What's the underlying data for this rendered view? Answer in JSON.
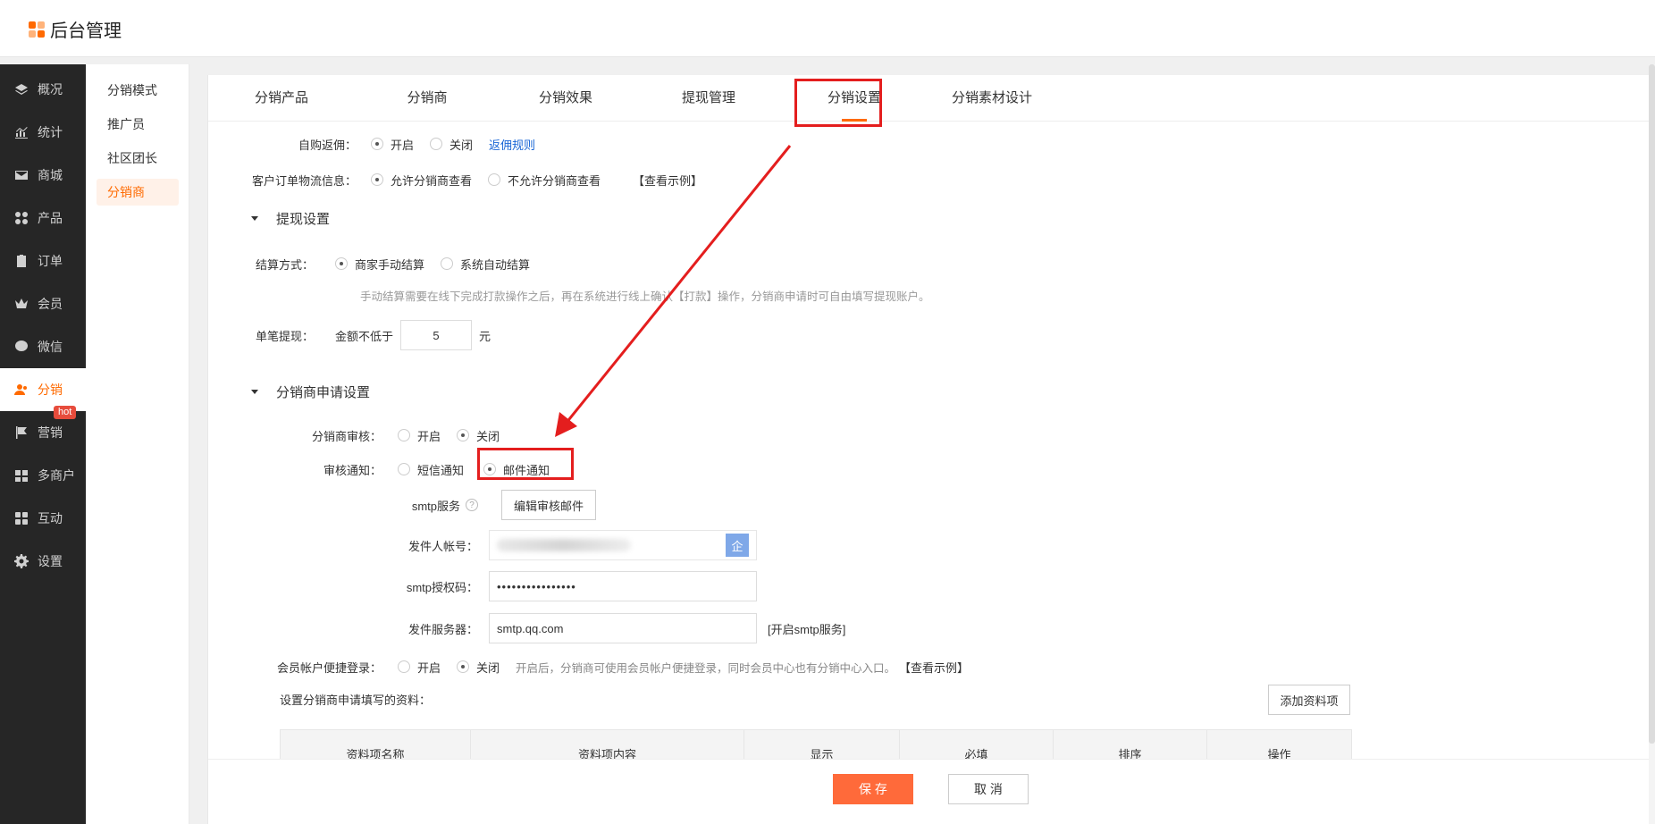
{
  "app": {
    "title": "后台管理"
  },
  "sidebar": {
    "items": [
      {
        "label": "概况",
        "icon": "layers-icon"
      },
      {
        "label": "统计",
        "icon": "chart-icon"
      },
      {
        "label": "商城",
        "icon": "mail-icon"
      },
      {
        "label": "产品",
        "icon": "grid-icon"
      },
      {
        "label": "订单",
        "icon": "clipboard-icon"
      },
      {
        "label": "会员",
        "icon": "crown-icon"
      },
      {
        "label": "微信",
        "icon": "wechat-icon"
      },
      {
        "label": "分销",
        "icon": "users-icon",
        "active": true
      },
      {
        "label": "营销",
        "icon": "flag-icon",
        "badge": "hot"
      },
      {
        "label": "多商户",
        "icon": "store-icon"
      },
      {
        "label": "互动",
        "icon": "blocks-icon"
      },
      {
        "label": "设置",
        "icon": "gear-icon"
      }
    ]
  },
  "subnav": {
    "items": [
      {
        "label": "分销模式"
      },
      {
        "label": "推广员"
      },
      {
        "label": "社区团长"
      },
      {
        "label": "分销商",
        "active": true
      }
    ]
  },
  "tabs": [
    {
      "label": "分销产品"
    },
    {
      "label": "分销商"
    },
    {
      "label": "分销效果"
    },
    {
      "label": "提现管理"
    },
    {
      "label": "分销设置",
      "active": true
    },
    {
      "label": "分销素材设计"
    }
  ],
  "form": {
    "self_rebate": {
      "label": "自购返佣：",
      "opt_on": "开启",
      "opt_off": "关闭",
      "selected": "开启",
      "link": "返佣规则"
    },
    "logistics": {
      "label": "客户订单物流信息：",
      "opt_allow": "允许分销商查看",
      "opt_deny": "不允许分销商查看",
      "selected": "允许分销商查看",
      "link": "【查看示例】"
    },
    "withdraw_section": "提现设置",
    "settle": {
      "label": "结算方式：",
      "opt_manual": "商家手动结算",
      "opt_auto": "系统自动结算",
      "selected": "商家手动结算",
      "hint": "手动结算需要在线下完成打款操作之后，再在系统进行线上确认【打款】操作，分销商申请时可自由填写提现账户。"
    },
    "single_withdraw": {
      "label": "单笔提现：",
      "prefix": "金额不低于",
      "value": "5",
      "suffix": "元"
    },
    "apply_section": "分销商申请设置",
    "review": {
      "label": "分销商审核：",
      "opt_on": "开启",
      "opt_off": "关闭",
      "selected": "关闭"
    },
    "notify": {
      "label": "审核通知：",
      "opt_sms": "短信通知",
      "opt_mail": "邮件通知",
      "selected": "邮件通知"
    },
    "smtp": {
      "label": "smtp服务",
      "help": "?",
      "edit_button": "编辑审核邮件"
    },
    "sender": {
      "label": "发件人帐号：",
      "addon": "企"
    },
    "auth_code": {
      "label": "smtp授权码：",
      "value": "••••••••••••••••"
    },
    "server": {
      "label": "发件服务器：",
      "value": "smtp.qq.com",
      "link": "[开启smtp服务]"
    },
    "quick_login": {
      "label": "会员帐户便捷登录：",
      "opt_on": "开启",
      "opt_off": "关闭",
      "selected": "关闭",
      "hint": "开启后，分销商可使用会员帐户便捷登录，同时会员中心也有分销中心入口。",
      "link": "【查看示例】"
    },
    "apply_fields": {
      "label": "设置分销商申请填写的资料：",
      "add_button": "添加资料项"
    },
    "table_headers": [
      "资料项名称",
      "资料项内容",
      "显示",
      "必填",
      "排序",
      "操作"
    ]
  },
  "footer": {
    "save": "保 存",
    "cancel": "取 消"
  },
  "colors": {
    "accent": "#ff6a00",
    "annotation": "#e41e1e",
    "sidebar_bg": "#262626"
  }
}
